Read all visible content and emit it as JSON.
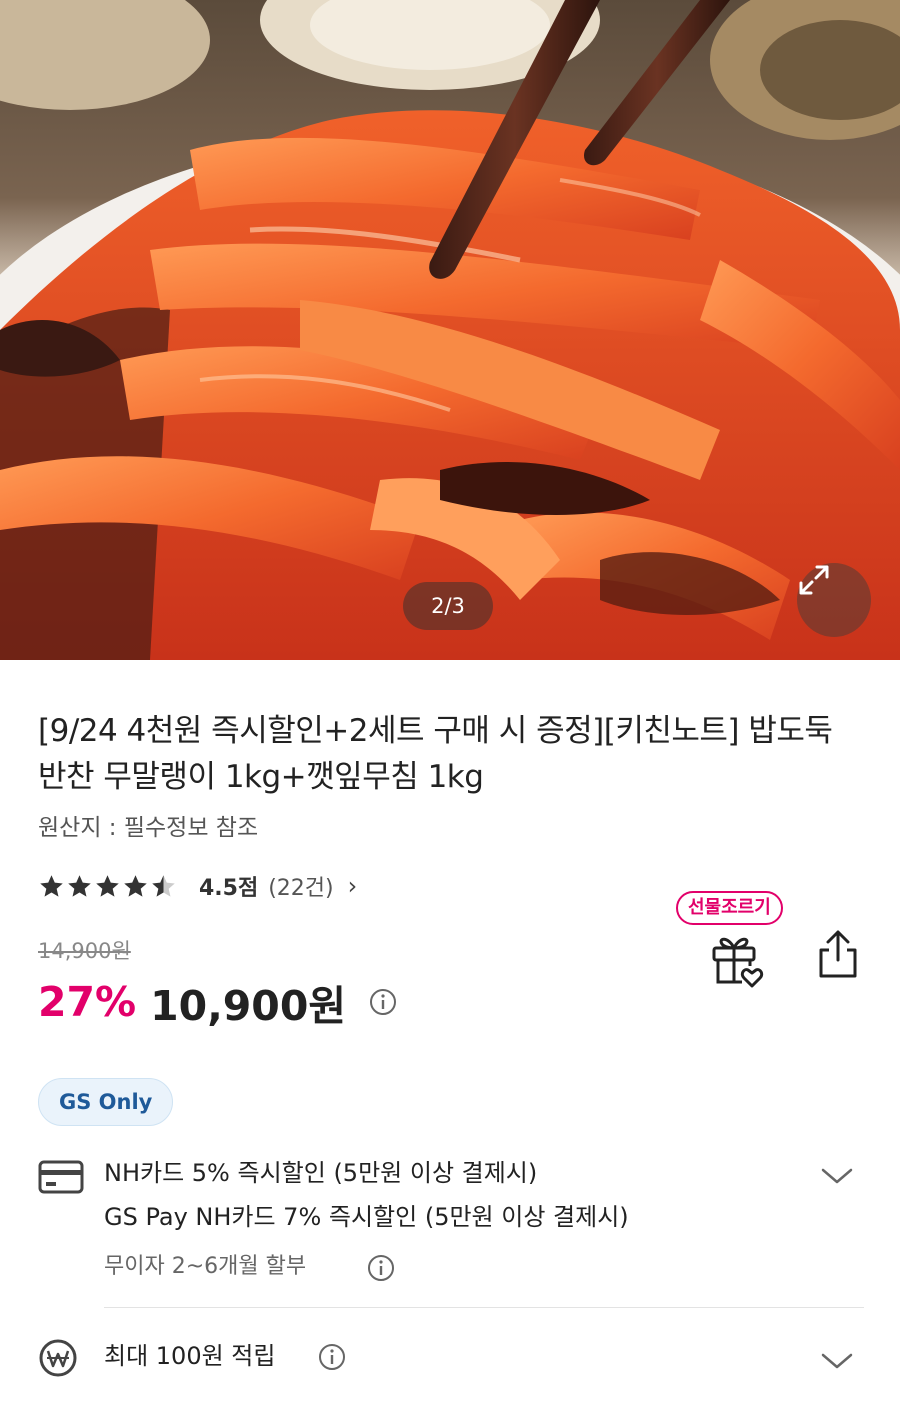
{
  "gallery": {
    "counter": "2/3",
    "current": 2,
    "total": 3
  },
  "product": {
    "title": "[9/24 4천원 즉시할인+2세트 구매 시 증정][키친노트] 밥도둑 반찬 무말랭이 1kg+깻잎무침 1kg",
    "origin": "원산지 : 필수정보 참조"
  },
  "rating": {
    "stars": 4.5,
    "score": "4.5점",
    "count": "(22건)"
  },
  "gift_tag": "선물조르기",
  "price": {
    "original": "14,900원",
    "discount": "27%",
    "final": "10,900원"
  },
  "badge": "GS Only",
  "benefits": {
    "card_line1": "NH카드 5% 즉시할인 (5만원 이상 결제시)",
    "card_line2": "GS Pay NH카드 7% 즉시할인 (5만원 이상 결제시)",
    "installment": "무이자 2~6개월 할부",
    "points": "최대 100원 적립"
  },
  "colors": {
    "accent": "#e2006a",
    "badge_bg": "#eaf3fb",
    "badge_text": "#1f5a99",
    "star": "#333333"
  }
}
